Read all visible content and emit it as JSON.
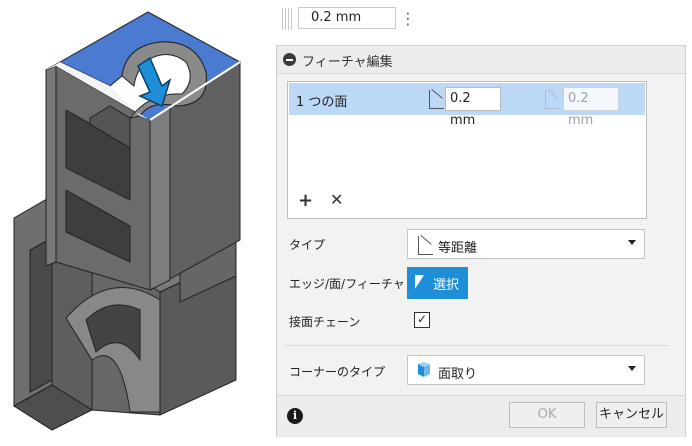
{
  "topbar": {
    "value": "0.2 mm"
  },
  "dialog": {
    "title": "フィーチャ編集",
    "face_list": {
      "rows": [
        {
          "name": "1 つの面",
          "distance1": "0.2 mm",
          "distance2": "0.2 mm"
        }
      ],
      "add_symbol": "+",
      "remove_symbol": "✕"
    },
    "type": {
      "label": "タイプ",
      "value": "等距離"
    },
    "edge_face_feature": {
      "label": "エッジ/面/フィーチャ",
      "button": "選択"
    },
    "tangent_chain": {
      "label": "接面チェーン",
      "checked": true,
      "mark": "✓"
    },
    "corner_type": {
      "label": "コーナーのタイプ",
      "value": "面取り"
    },
    "footer": {
      "info": "i",
      "ok": "OK",
      "cancel": "キャンセル"
    }
  },
  "colors": {
    "accent": "#1e8fd6",
    "selected_row": "#bcd8f4",
    "model_face": "#4a7bd0"
  },
  "icons": [
    "collapse-icon",
    "offset-page-icon",
    "cursor-icon",
    "chamfer-corner-icon",
    "info-icon",
    "arrow-icon",
    "menu-dots-icon"
  ]
}
